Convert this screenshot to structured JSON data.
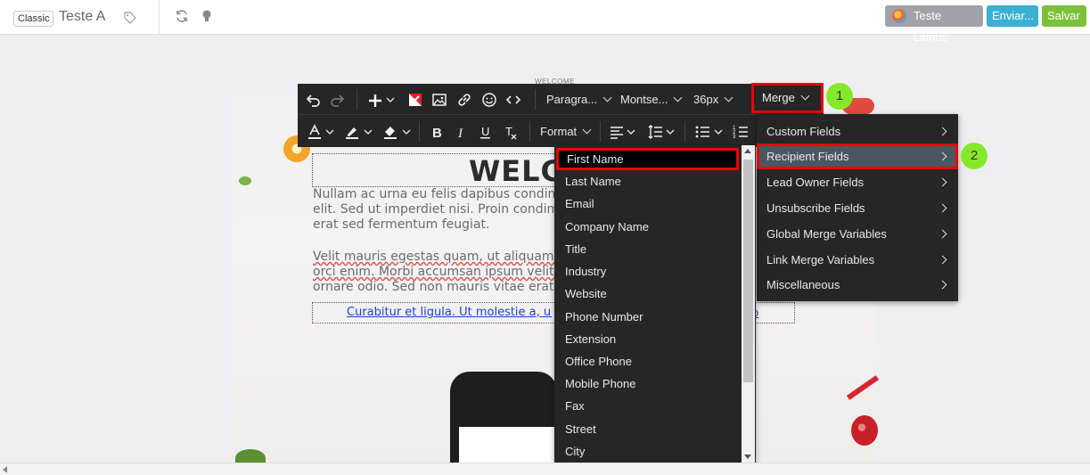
{
  "header": {
    "mode_badge": "Classic",
    "document_title": "Teste A",
    "litmus_label": "Teste Litmus",
    "send_label": "Enviar...",
    "save_label": "Salvar"
  },
  "canvas": {
    "section_label": "WELCOME",
    "heading": "WELCO",
    "paragraph1": "Nullam ac urna eu felis dapibus condime\nelit. Sed ut imperdiet nisi. Proin condime\nerat sed fermentum feugiat.",
    "paragraph2_line1": "Velit mauris egestas quam, ut aliquam m",
    "paragraph2_line2": "orci enim. Morbi accumsan ipsum velit. N",
    "paragraph2_line3": "ornare odio. Sed non mauris vitae erat c",
    "link_text": "Curabitur et ligula. Ut molestie a, ultri",
    "link_tail": "o"
  },
  "toolbar": {
    "paragraph_select": "Paragra...",
    "font_select": "Montse...",
    "size_select": "36px",
    "merge_label": "Merge",
    "format_label": "Format"
  },
  "annotations": {
    "step1": "1",
    "step2": "2"
  },
  "merge_menu": {
    "items": [
      {
        "label": "Custom Fields"
      },
      {
        "label": "Recipient Fields"
      },
      {
        "label": "Lead Owner Fields"
      },
      {
        "label": "Unsubscribe Fields"
      },
      {
        "label": "Global Merge Variables"
      },
      {
        "label": "Link Merge Variables"
      },
      {
        "label": "Miscellaneous"
      }
    ],
    "active_index": 1
  },
  "recipient_fields": {
    "items": [
      {
        "label": "First Name"
      },
      {
        "label": "Last Name"
      },
      {
        "label": "Email"
      },
      {
        "label": "Company Name"
      },
      {
        "label": "Title"
      },
      {
        "label": "Industry"
      },
      {
        "label": "Website"
      },
      {
        "label": "Phone Number"
      },
      {
        "label": "Extension"
      },
      {
        "label": "Office Phone"
      },
      {
        "label": "Mobile Phone"
      },
      {
        "label": "Fax"
      },
      {
        "label": "Street"
      },
      {
        "label": "City"
      }
    ],
    "active_index": 0
  },
  "colors": {
    "highlight_border": "#ee0000",
    "step_circle": "#86e82a",
    "toolbar_bg": "#262626",
    "send_button": "#3cb0d3",
    "save_button": "#7cc13c"
  }
}
